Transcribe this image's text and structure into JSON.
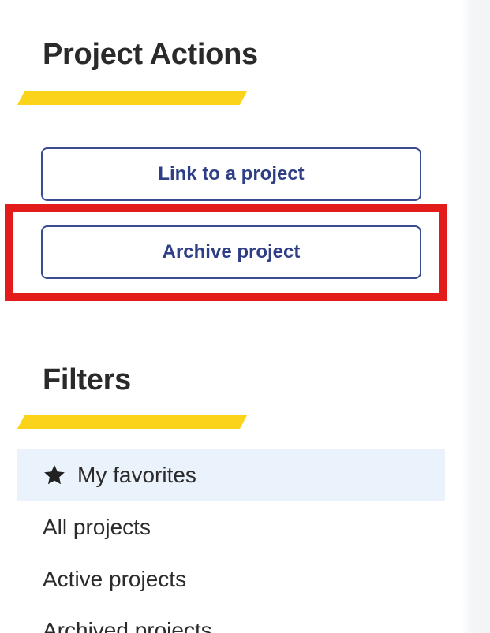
{
  "actions": {
    "heading": "Project Actions",
    "buttons": [
      {
        "label": "Link to a project"
      },
      {
        "label": "Archive project"
      }
    ],
    "highlighted_button": "Archive project",
    "highlight_color": "#e31b1b"
  },
  "filters": {
    "heading": "Filters",
    "items": [
      {
        "label": "My favorites",
        "icon": "star-icon",
        "active": true
      },
      {
        "label": "All projects",
        "active": false
      },
      {
        "label": "Active projects",
        "active": false
      },
      {
        "label": "Archived projects",
        "active": false
      }
    ]
  },
  "colors": {
    "accent": "#fbd31a",
    "button_border": "#3a4c8f",
    "button_text": "#2f3f85",
    "active_item_bg": "#eaf2fb"
  }
}
